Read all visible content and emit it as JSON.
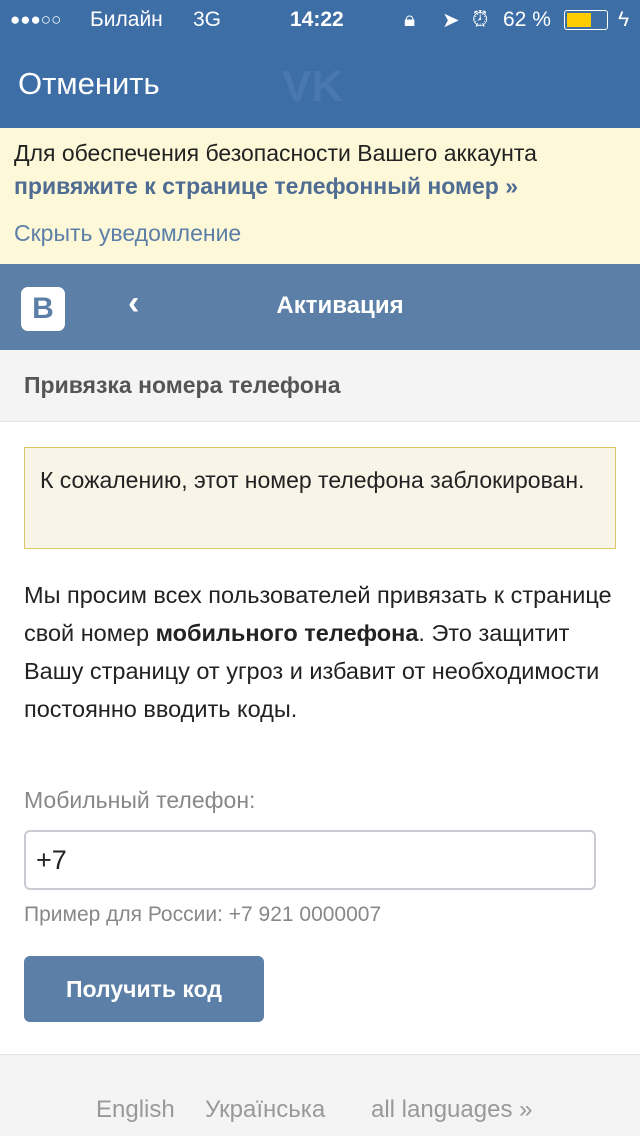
{
  "status_bar": {
    "signal": "●●●○○",
    "carrier": "Билайн",
    "network": "3G",
    "time": "14:22",
    "battery": "62 %",
    "battery_level": 0.62,
    "battery_color": "#ffcc00"
  },
  "top_nav": {
    "cancel_label": "Отменить",
    "watermark": "VK"
  },
  "notice": {
    "line1": "Для обеспечения безопасности Вашего аккаунта",
    "link": "привяжите к странице телефонный номер »",
    "hide": "Скрыть уведомление"
  },
  "header": {
    "logo": "B",
    "title": "Активация"
  },
  "section_title": "Привязка номера телефона",
  "warning": "К сожалению, этот номер телефона заблокирован.",
  "description": {
    "part1": "Мы просим всех пользователей привязать к странице свой номер ",
    "bold": "мобильного телефона",
    "part2": ". Это защитит Вашу страницу от угроз и избавит от необходимости постоянно вводить коды."
  },
  "phone": {
    "label": "Мобильный телефон:",
    "value": "+7",
    "hint": "Пример для России: +7 921 0000007"
  },
  "submit_label": "Получить код",
  "footer": {
    "languages": [
      "English",
      "Українська",
      "all languages »"
    ]
  },
  "colors": {
    "brand": "#3d6ea6",
    "header": "#5b7fa6",
    "notice_bg": "#fdf8d8"
  }
}
